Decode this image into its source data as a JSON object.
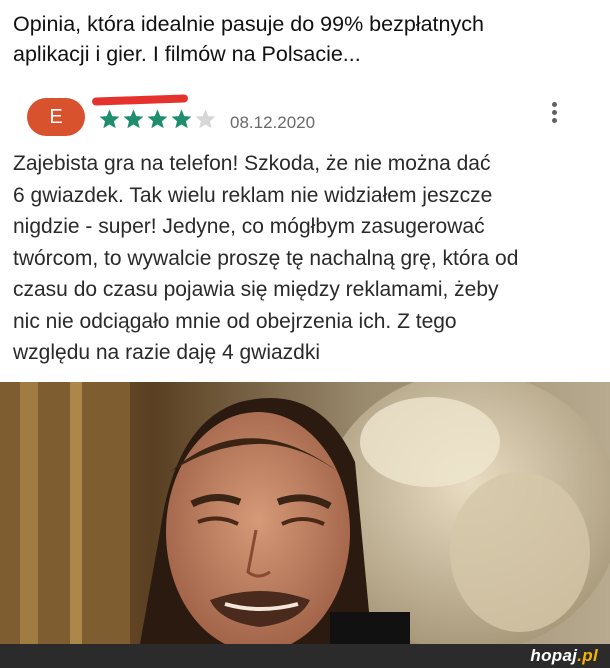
{
  "caption": {
    "line1": "Opinia, która idealnie pasuje do 99% bezpłatnych",
    "line2": "aplikacji i gier. I filmów na Polsacie..."
  },
  "review": {
    "avatar_letter": "E",
    "rating": 4,
    "max_rating": 5,
    "date": "08.12.2020",
    "text_lines": [
      "Zajebista gra na telefon! Szkoda, że nie można dać",
      "6 gwiazdek. Tak wielu reklam nie widziałem jeszcze",
      "nigdzie - super! Jedyne, co mógłbym zasugerować",
      "twórcom, to wywalcie proszę tę nachalną grę, która od",
      "czasu do czasu pojawia się między reklamami, żeby",
      "nic nie odciągało mnie od obejrzenia ich. Z tego",
      "względu na razie daję 4 gwiazdki"
    ]
  },
  "footer": {
    "logo_main": "hopaj",
    "logo_accent": ".pl"
  },
  "colors": {
    "avatar": "#d9522e",
    "star_filled": "#1e8e6e",
    "star_empty": "#d6d6d6",
    "redaction": "#e5322d",
    "logo_accent": "#f7b500"
  },
  "icons": {
    "more": "more-vertical-icon",
    "star": "star-icon"
  }
}
